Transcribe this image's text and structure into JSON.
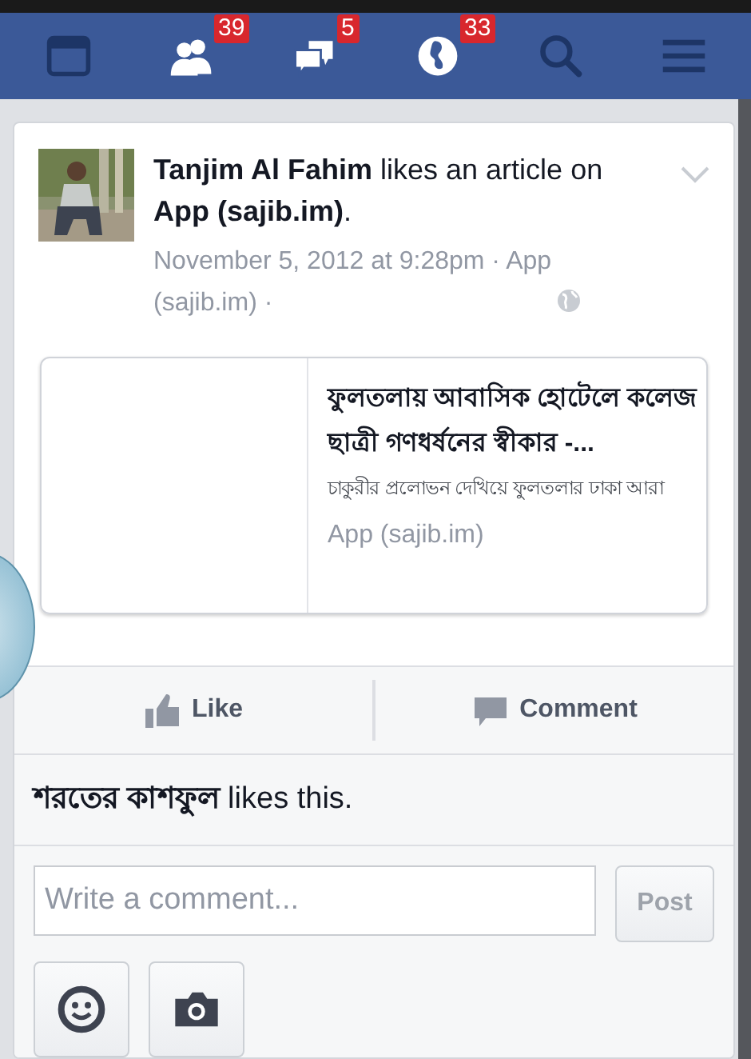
{
  "nav": [
    {
      "kind": "feed"
    },
    {
      "kind": "friends",
      "badge": "39"
    },
    {
      "kind": "messages",
      "badge": "5"
    },
    {
      "kind": "notifications",
      "badge": "33"
    },
    {
      "kind": "search"
    },
    {
      "kind": "menu"
    }
  ],
  "story": {
    "actor": "Tanjim Al Fahim",
    "verb": "likes an article on",
    "target": "App (sajib.im)",
    "end": ".",
    "meta": "November 5, 2012 at 9:28pm · App (sajib.im) ·",
    "attachment": {
      "title": "ফুলতলায় আবাসিক হোটেলে কলেজ ছাত্রী গণধর্ষনের স্বীকার -...",
      "summary": "চাকুরীর প্রলোভন দেখিয়ে ফুলতলার ঢাকা আরা",
      "source": "App (sajib.im)"
    },
    "actions": [
      {
        "kind": "like",
        "label": "Like"
      },
      {
        "kind": "comment",
        "label": "Comment"
      }
    ],
    "likes": "**শরতের কাশফুল** likes this.",
    "comment": {
      "placeholder": "Write a comment...",
      "post": "Post",
      "post_disabled": true
    },
    "tools": [
      {
        "kind": "emoji"
      },
      {
        "kind": "camera"
      }
    ]
  }
}
